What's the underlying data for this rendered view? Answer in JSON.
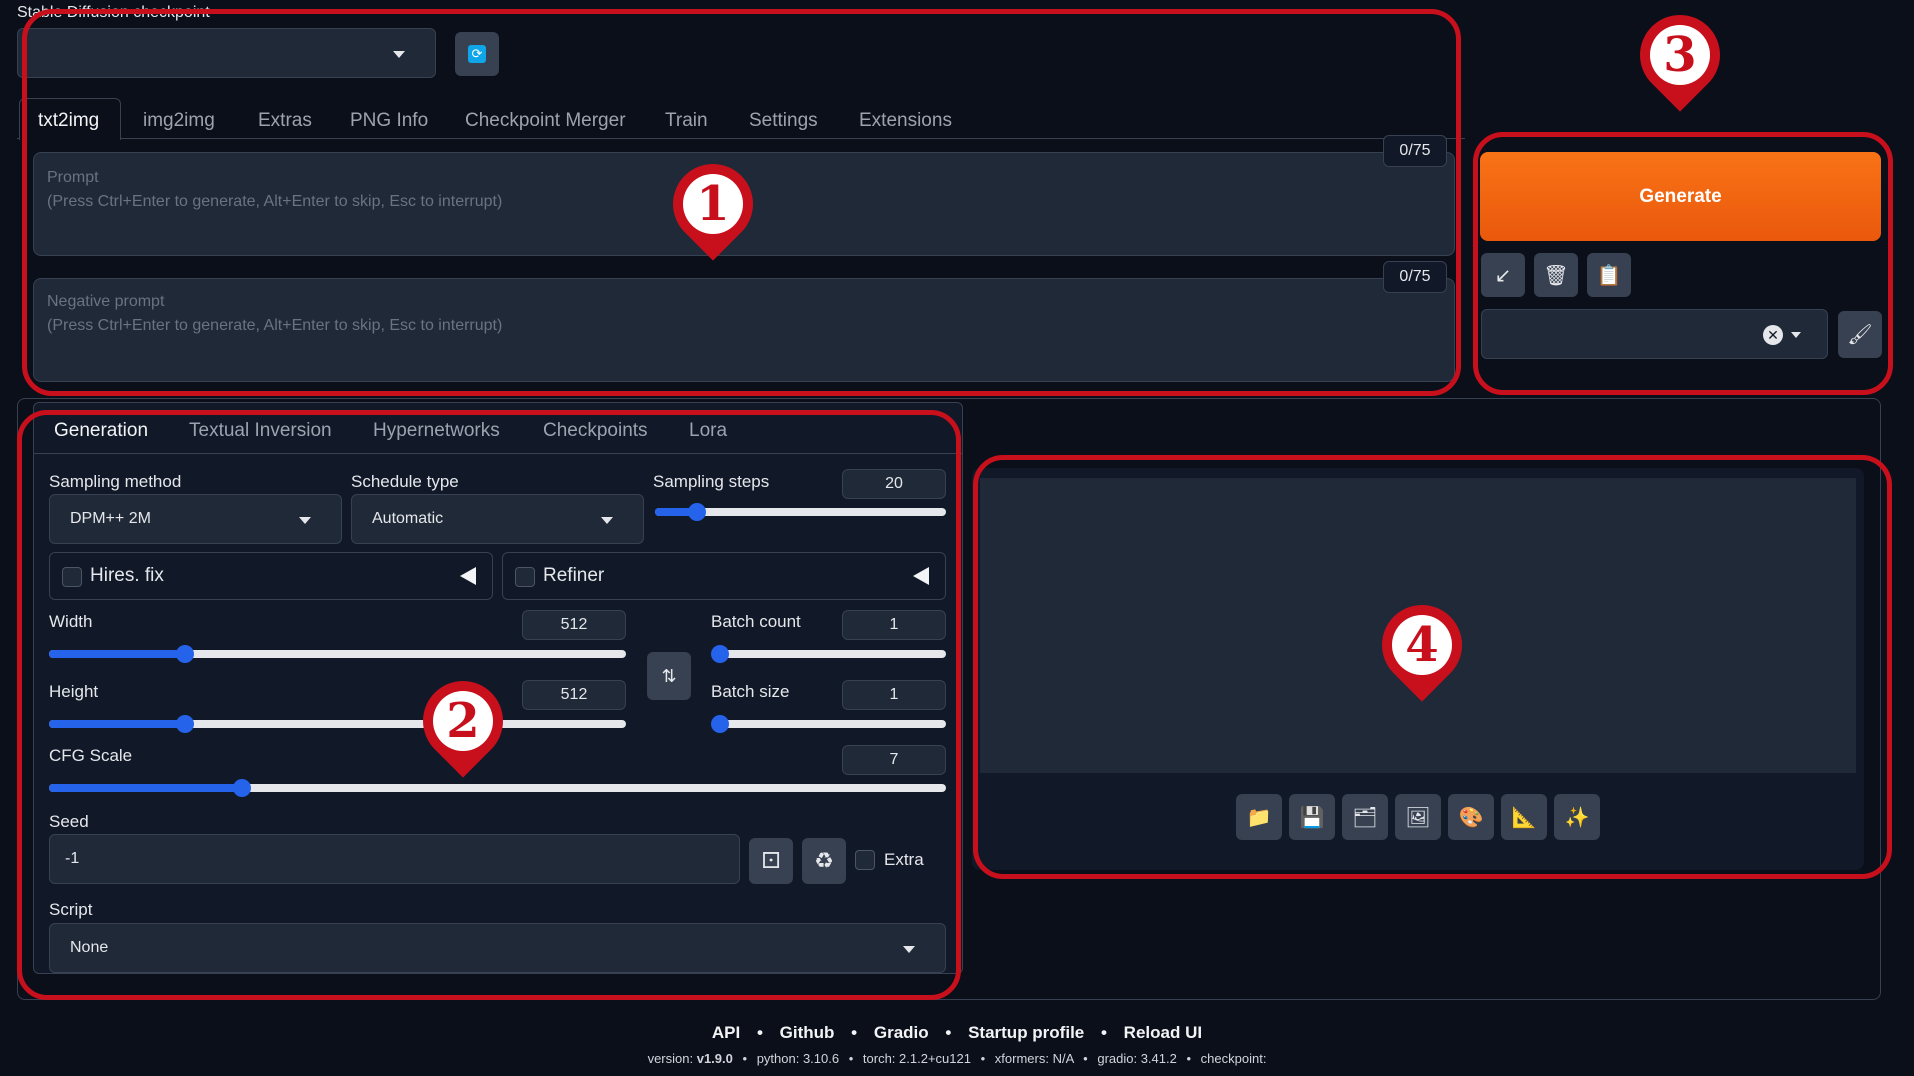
{
  "checkpoint": {
    "label": "Stable Diffusion checkpoint",
    "value": ""
  },
  "main_tabs": [
    {
      "label": "txt2img"
    },
    {
      "label": "img2img"
    },
    {
      "label": "Extras"
    },
    {
      "label": "PNG Info"
    },
    {
      "label": "Checkpoint Merger"
    },
    {
      "label": "Train"
    },
    {
      "label": "Settings"
    },
    {
      "label": "Extensions"
    }
  ],
  "prompt": {
    "label": "Prompt",
    "placeholder": "(Press Ctrl+Enter to generate, Alt+Enter to skip, Esc to interrupt)",
    "counter": "0/75"
  },
  "negative_prompt": {
    "label": "Negative prompt",
    "placeholder": "(Press Ctrl+Enter to generate, Alt+Enter to skip, Esc to interrupt)",
    "counter": "0/75"
  },
  "generate": {
    "label": "Generate"
  },
  "sub_tabs": [
    {
      "label": "Generation"
    },
    {
      "label": "Textual Inversion"
    },
    {
      "label": "Hypernetworks"
    },
    {
      "label": "Checkpoints"
    },
    {
      "label": "Lora"
    }
  ],
  "sampling_method": {
    "label": "Sampling method",
    "value": "DPM++ 2M"
  },
  "schedule_type": {
    "label": "Schedule type",
    "value": "Automatic"
  },
  "sampling_steps": {
    "label": "Sampling steps",
    "value": "20"
  },
  "hires": {
    "label": "Hires. fix"
  },
  "refiner": {
    "label": "Refiner"
  },
  "width": {
    "label": "Width",
    "value": "512"
  },
  "height": {
    "label": "Height",
    "value": "512"
  },
  "batch_count": {
    "label": "Batch count",
    "value": "1"
  },
  "batch_size": {
    "label": "Batch size",
    "value": "1"
  },
  "cfg": {
    "label": "CFG Scale",
    "value": "7"
  },
  "seed": {
    "label": "Seed",
    "value": "-1",
    "extra": "Extra"
  },
  "script": {
    "label": "Script",
    "value": "None"
  },
  "markers": [
    "1",
    "2",
    "3",
    "4"
  ],
  "footer": {
    "links": [
      "API",
      "Github",
      "Gradio",
      "Startup profile",
      "Reload UI"
    ],
    "sep": "•",
    "version_label": "version:",
    "version": "v1.9.0",
    "python": "python: 3.10.6",
    "torch": "torch: 2.1.2+cu121",
    "xformers": "xformers: N/A",
    "gradio": "gradio: 3.41.2",
    "checkpoint": "checkpoint:"
  },
  "colors": {
    "accent": "#2563eb",
    "generate": "#f97316",
    "annotation": "#c8101c"
  }
}
